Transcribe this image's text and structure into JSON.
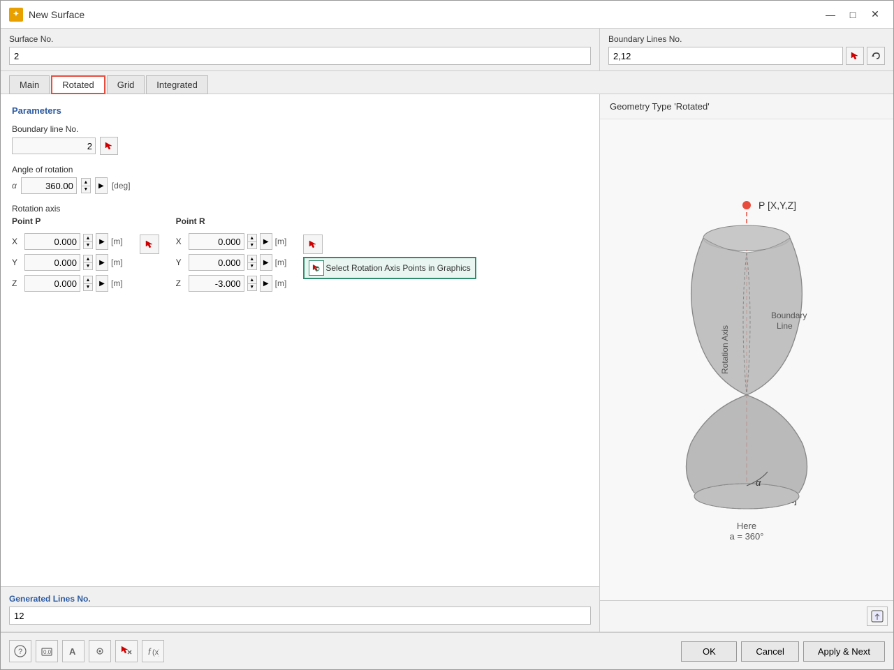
{
  "window": {
    "title": "New Surface",
    "icon": "★"
  },
  "surface_no": {
    "label": "Surface No.",
    "value": "2"
  },
  "boundary_lines": {
    "label": "Boundary Lines No.",
    "value": "2,12"
  },
  "tabs": [
    {
      "label": "Main",
      "active": false
    },
    {
      "label": "Rotated",
      "active": true
    },
    {
      "label": "Grid",
      "active": false
    },
    {
      "label": "Integrated",
      "active": false
    }
  ],
  "parameters": {
    "title": "Parameters",
    "boundary_line": {
      "label": "Boundary line No.",
      "value": "2"
    },
    "angle_of_rotation": {
      "label": "Angle of rotation",
      "alpha_label": "α",
      "value": "360.00",
      "unit": "[deg]"
    },
    "rotation_axis": {
      "label": "Rotation axis",
      "point_p_label": "Point P",
      "point_r_label": "Point R",
      "p_x": "0.000",
      "p_y": "0.000",
      "p_z": "0.000",
      "r_x": "0.000",
      "r_y": "0.000",
      "r_z": "-3.000",
      "unit": "[m]",
      "select_btn_label": "Select Rotation Axis Points in Graphics"
    }
  },
  "generated_lines": {
    "label": "Generated Lines No.",
    "value": "12"
  },
  "diagram": {
    "title": "Geometry Type 'Rotated'",
    "p_label": "P [X,Y,Z]",
    "r_label": "R [X,Y,Z]",
    "rotation_axis_label": "Rotation Axis",
    "boundary_line_label": "Boundary Line",
    "alpha_label": "α",
    "note": "Here",
    "note2": "a = 360°"
  },
  "buttons": {
    "ok": "OK",
    "cancel": "Cancel",
    "apply_next": "Apply & Next"
  },
  "title_controls": {
    "minimize": "—",
    "maximize": "□",
    "close": "✕"
  }
}
